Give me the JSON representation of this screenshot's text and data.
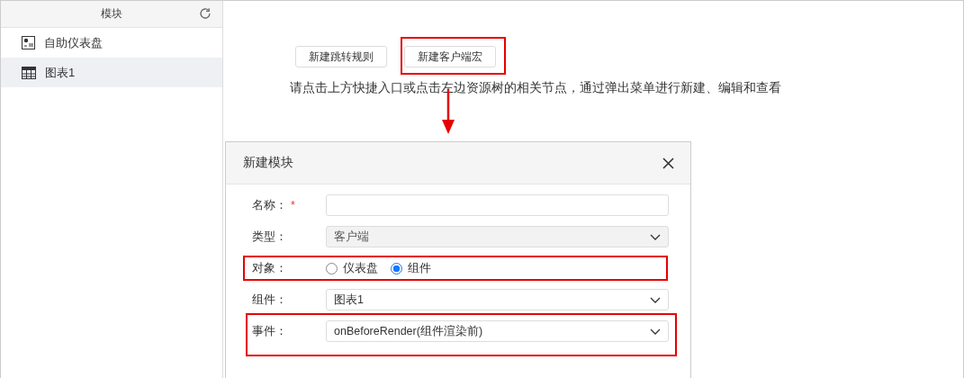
{
  "sidebar": {
    "title": "模块",
    "items": [
      {
        "label": "自助仪表盘",
        "kind": "dashboard",
        "selected": false
      },
      {
        "label": "图表1",
        "kind": "table",
        "selected": true
      }
    ]
  },
  "toolbar": {
    "buttons": [
      "新建跳转规则",
      "新建客户端宏"
    ]
  },
  "hint": "请点击上方快捷入口或点击左边资源树的相关节点，通过弹出菜单进行新建、编辑和查看",
  "dialog": {
    "title": "新建模块",
    "fields": [
      {
        "kind": "text",
        "label": "名称：",
        "required_mark": "*"
      },
      {
        "kind": "select",
        "label": "类型：",
        "value": "客户端",
        "disabled": true
      },
      {
        "kind": "radio",
        "label": "对象：",
        "options": [
          {
            "label": "仪表盘",
            "selected": false
          },
          {
            "label": "组件",
            "selected": true
          }
        ]
      },
      {
        "kind": "select",
        "label": "组件：",
        "value": "图表1",
        "disabled": false
      },
      {
        "kind": "select",
        "label": "事件：",
        "value": "onBeforeRender(组件渲染前)",
        "disabled": false
      }
    ]
  }
}
